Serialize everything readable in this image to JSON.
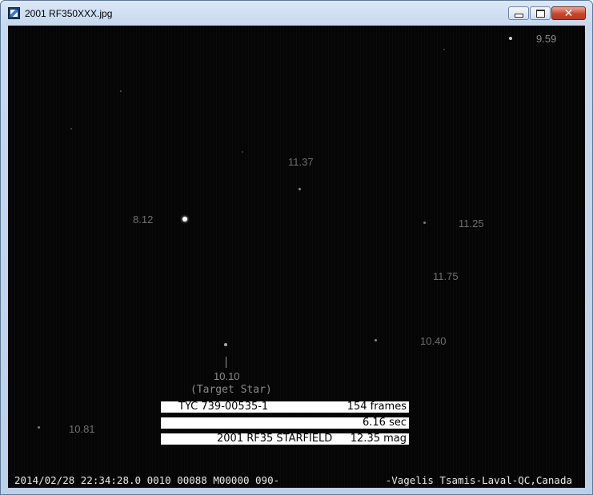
{
  "window": {
    "title": "2001 RF350XXX.jpg",
    "icons": {
      "app": "image-viewer-icon",
      "minimize": "minimize-icon",
      "maximize": "maximize-icon",
      "close": "close-icon"
    },
    "close_glyph": "✕"
  },
  "starfield": {
    "magnitudes": {
      "m959": "9.59",
      "m1137": "11.37",
      "m812": "8.12",
      "m1125": "11.25",
      "m1175": "11.75",
      "m1040": "10.40",
      "m1010": "10.10",
      "m1081": "10.81"
    },
    "target_caption": "(Target Star)"
  },
  "info_bars": {
    "row1_left": "TYC  739-00535-1",
    "row1_right": "154 frames",
    "row2_right": "6.16  sec",
    "row3_left": "2001 RF35 STARFIELD",
    "row3_right": "12.35 mag"
  },
  "footer": {
    "timestamp_line": "2014/02/28 22:34:28.0 0010  00088 M00000 090-",
    "credit": "-Vagelis Tsamis-Laval-QC,Canada"
  },
  "colors": {
    "background": "#050505",
    "label": "#6f6f6f",
    "bar": "#ffffff"
  }
}
